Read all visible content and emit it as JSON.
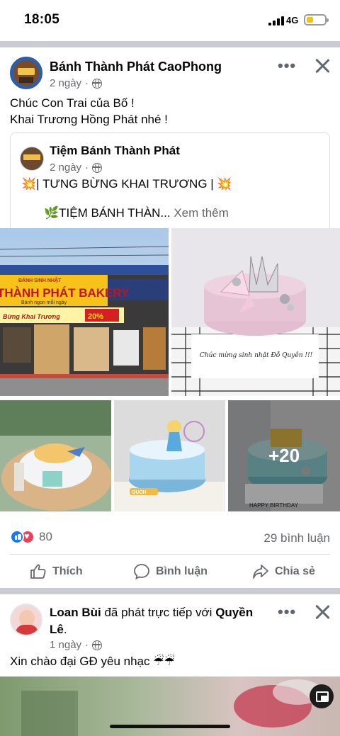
{
  "status_bar": {
    "time": "18:05",
    "network": "4G"
  },
  "post1": {
    "author": "Bánh Thành Phát CaoPhong",
    "time": "2 ngày",
    "text_line1": "Chúc Con Trai của Bố !",
    "text_line2": "Khai Trương Hồng Phát nhé !",
    "shared": {
      "author": "Tiệm Bánh Thành Phát",
      "time": "2 ngày",
      "line1": "💥| TƯNG BỪNG KHAI TRƯƠNG | 💥",
      "line2": "🌿TIỆM BÁNH THÀN...",
      "see_more": "Xem thêm"
    },
    "photos": {
      "storefront_sign_top": "BÁNH SINH NHẬT",
      "storefront_sign_main": "THÀNH PHÁT BAKERY",
      "storefront_sign_sub": "Bánh ngon mỗi ngày",
      "storefront_banner": "Bừng Khai Trương",
      "storefront_banner_discount": "20%",
      "cake2_text": "Chúc mừng sinh nhật Đỗ Quyên !!!",
      "cake4_badge": "OUCH",
      "cake5_text": "HAPPY BIRTHDAY",
      "more_count": "+20"
    },
    "reaction_count": "80",
    "comments": "29 bình luận",
    "actions": {
      "like": "Thích",
      "comment": "Bình luận",
      "share": "Chia sẻ"
    }
  },
  "post2": {
    "author": "Loan Bùi",
    "action_text": "đã phát trực tiếp với",
    "tagged_line1": "Quyền",
    "tagged_line2": "Lê",
    "time": "1 ngày",
    "text": "Xin chào đại GĐ yêu nhạc ☔☔"
  },
  "colors": {
    "accent_blue": "#1877f2",
    "love_red": "#f33e58",
    "secondary_text": "#65676b",
    "battery_yellow": "#f5c400"
  }
}
